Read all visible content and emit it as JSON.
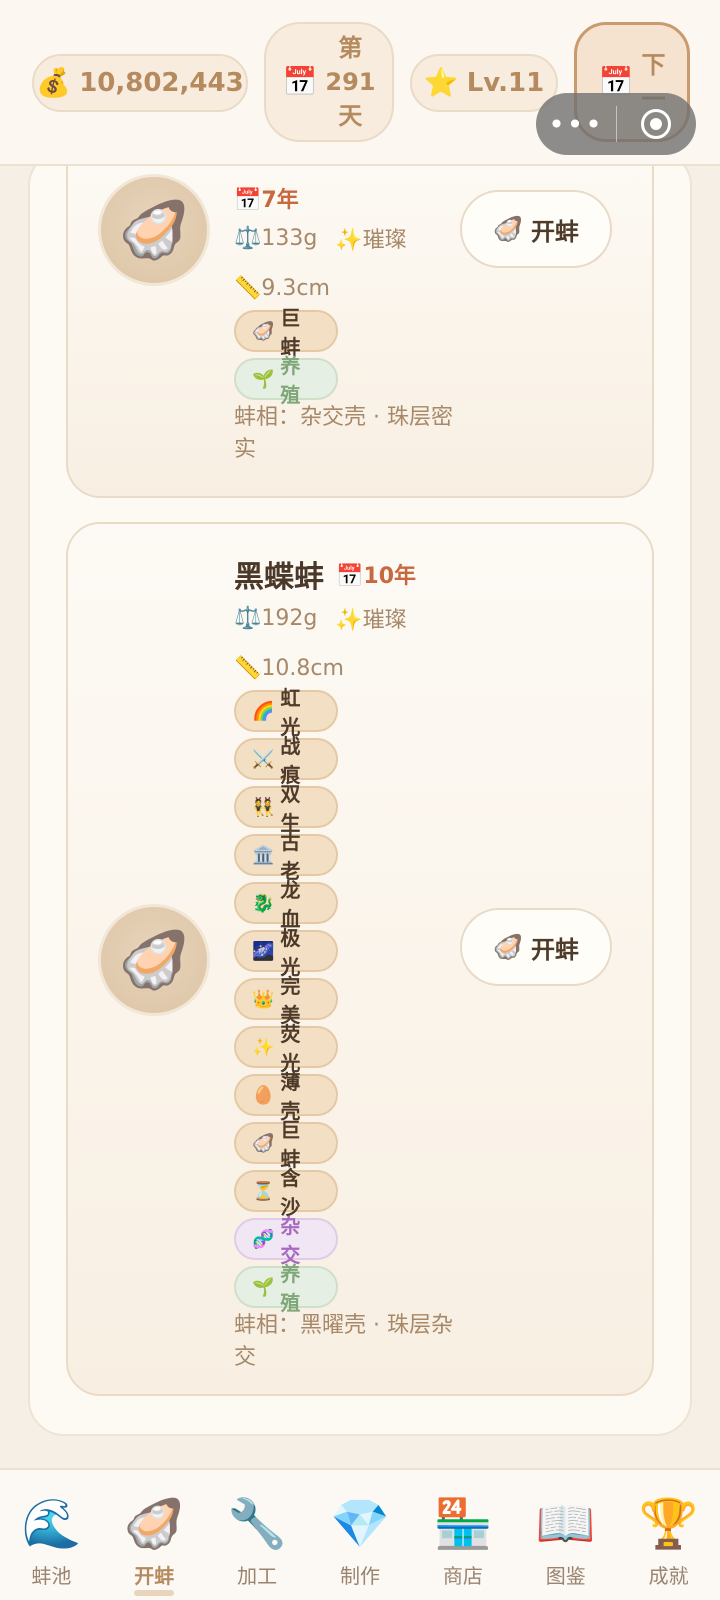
{
  "header": {
    "money": "10,802,443",
    "day_lines": [
      "第",
      "291",
      "天"
    ],
    "level": "Lv.11",
    "next_lines": [
      "下",
      "一",
      ""
    ]
  },
  "items": [
    {
      "name": "",
      "age": "7年",
      "weight": "133g",
      "quality": "璀璨",
      "size": "9.3cm",
      "tags": [
        {
          "icon": "🦪",
          "label": "巨蚌",
          "style": "default"
        },
        {
          "icon": "🌱",
          "label": "养殖",
          "style": "green"
        }
      ],
      "desc": "蚌相：杂交壳 · 珠层密实",
      "button": "开蚌"
    },
    {
      "name": "黑蝶蚌",
      "age": "10年",
      "weight": "192g",
      "quality": "璀璨",
      "size": "10.8cm",
      "tags": [
        {
          "icon": "🌈",
          "label": "虹光",
          "style": "default"
        },
        {
          "icon": "⚔️",
          "label": "战痕",
          "style": "default"
        },
        {
          "icon": "👯",
          "label": "双生",
          "style": "default"
        },
        {
          "icon": "🏛️",
          "label": "古老",
          "style": "default"
        },
        {
          "icon": "🐉",
          "label": "龙血",
          "style": "default"
        },
        {
          "icon": "🌌",
          "label": "极光",
          "style": "default"
        },
        {
          "icon": "👑",
          "label": "完美",
          "style": "default"
        },
        {
          "icon": "✨",
          "label": "荧光",
          "style": "default"
        },
        {
          "icon": "🥚",
          "label": "薄壳",
          "style": "default"
        },
        {
          "icon": "🦪",
          "label": "巨蚌",
          "style": "default"
        },
        {
          "icon": "⏳",
          "label": "含沙",
          "style": "default"
        },
        {
          "icon": "🧬",
          "label": "杂交",
          "style": "purple"
        },
        {
          "icon": "🌱",
          "label": "养殖",
          "style": "green"
        }
      ],
      "desc": "蚌相：黑曜壳 · 珠层杂交",
      "button": "开蚌"
    }
  ],
  "tabs": [
    {
      "icon": "🌊",
      "label": "蚌池",
      "active": false
    },
    {
      "icon": "🦪",
      "label": "开蚌",
      "active": true
    },
    {
      "icon": "🔧",
      "label": "加工",
      "active": false
    },
    {
      "icon": "💎",
      "label": "制作",
      "active": false
    },
    {
      "icon": "🏪",
      "label": "商店",
      "active": false
    },
    {
      "icon": "📖",
      "label": "图鉴",
      "active": false
    },
    {
      "icon": "🏆",
      "label": "成就",
      "active": false
    }
  ]
}
